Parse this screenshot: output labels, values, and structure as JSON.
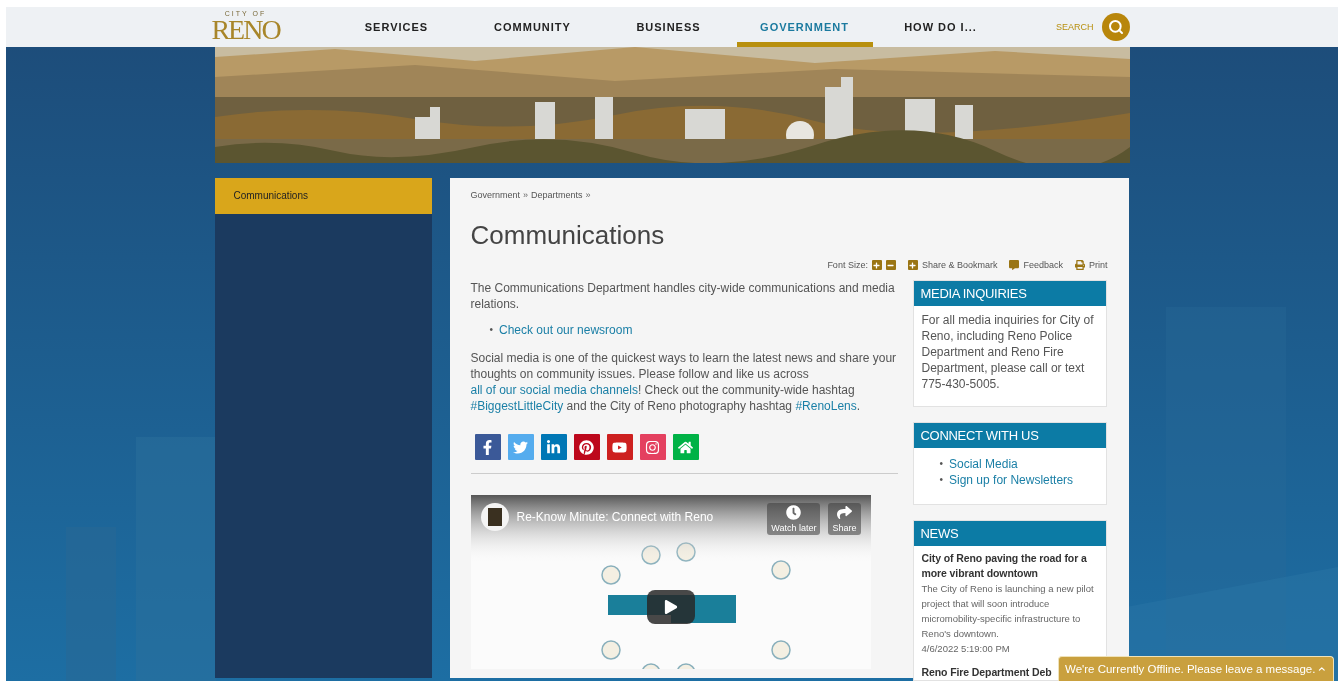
{
  "header": {
    "logo": {
      "small": "CITY OF",
      "name": "RENO"
    },
    "nav": [
      {
        "label": "SERVICES",
        "selected": false
      },
      {
        "label": "COMMUNITY",
        "selected": false
      },
      {
        "label": "BUSINESS",
        "selected": false
      },
      {
        "label": "GOVERNMENT",
        "selected": true
      },
      {
        "label": "HOW DO I...",
        "selected": false
      }
    ],
    "search": {
      "label": "SEARCH"
    }
  },
  "sidebar": {
    "items": [
      {
        "label": "Communications",
        "selected": true
      }
    ]
  },
  "breadcrumb": [
    {
      "label": "Government",
      "separator": "»"
    },
    {
      "label": "Departments",
      "separator": "»"
    }
  ],
  "title": "Communications",
  "tools": {
    "font_size_label": "Font Size:",
    "share": "Share & Bookmark",
    "feedback": "Feedback",
    "print": "Print"
  },
  "intro": "The Communications Department handles city-wide communications and media relations.",
  "links": [
    {
      "marker": "•",
      "text": "Check out our newsroom"
    }
  ],
  "social_paragraph": [
    {
      "text": "Social media is one of the quickest ways to learn the latest news and share your thoughts on community issues. Please follow and like us across ",
      "link": false
    },
    {
      "text": "all of our social media channels",
      "link": true
    },
    {
      "text": "! Check out the community-wide hashtag ",
      "link": false
    },
    {
      "text": "#BiggestLittleCity",
      "link": true
    },
    {
      "text": " and the City of Reno photography hashtag ",
      "link": false
    },
    {
      "text": "#RenoLens",
      "link": true
    },
    {
      "text": ".",
      "link": false
    }
  ],
  "social_icons": [
    {
      "color": "#3b5998"
    },
    {
      "color": "#55acee"
    },
    {
      "color": "#0077b5"
    },
    {
      "color": "#bd081c"
    },
    {
      "color": "#cd201f"
    },
    {
      "color": "#e4405f"
    },
    {
      "color": "#00b246"
    }
  ],
  "video": {
    "title": "Re-Know Minute: Connect with Reno",
    "actions": [
      {
        "label": "Watch later"
      },
      {
        "label": "Share"
      }
    ]
  },
  "aside": [
    {
      "kind": "text",
      "heading": "MEDIA INQUIRIES",
      "text": "For all media inquiries for City of Reno, including Reno Police Department and Reno Fire Department, please call or text 775-430-5005."
    },
    {
      "kind": "links",
      "heading": "CONNECT WITH US",
      "links": [
        {
          "marker": "•",
          "text": "Social Media"
        },
        {
          "marker": "•",
          "text": "Sign up for Newsletters"
        }
      ]
    },
    {
      "kind": "news",
      "heading": "NEWS",
      "items": [
        {
          "title": "City of Reno paving the road for a more vibrant downtown",
          "summary": "The City of Reno is launching a new pilot project that will soon introduce micromobility-specific infrastructure to Reno's downtown.",
          "date": "4/6/2022 5:19:00 PM"
        },
        {
          "title": "Reno Fire Department Deb"
        }
      ]
    }
  ],
  "chat": {
    "text": "We're Currently Offline. Please leave a message."
  }
}
